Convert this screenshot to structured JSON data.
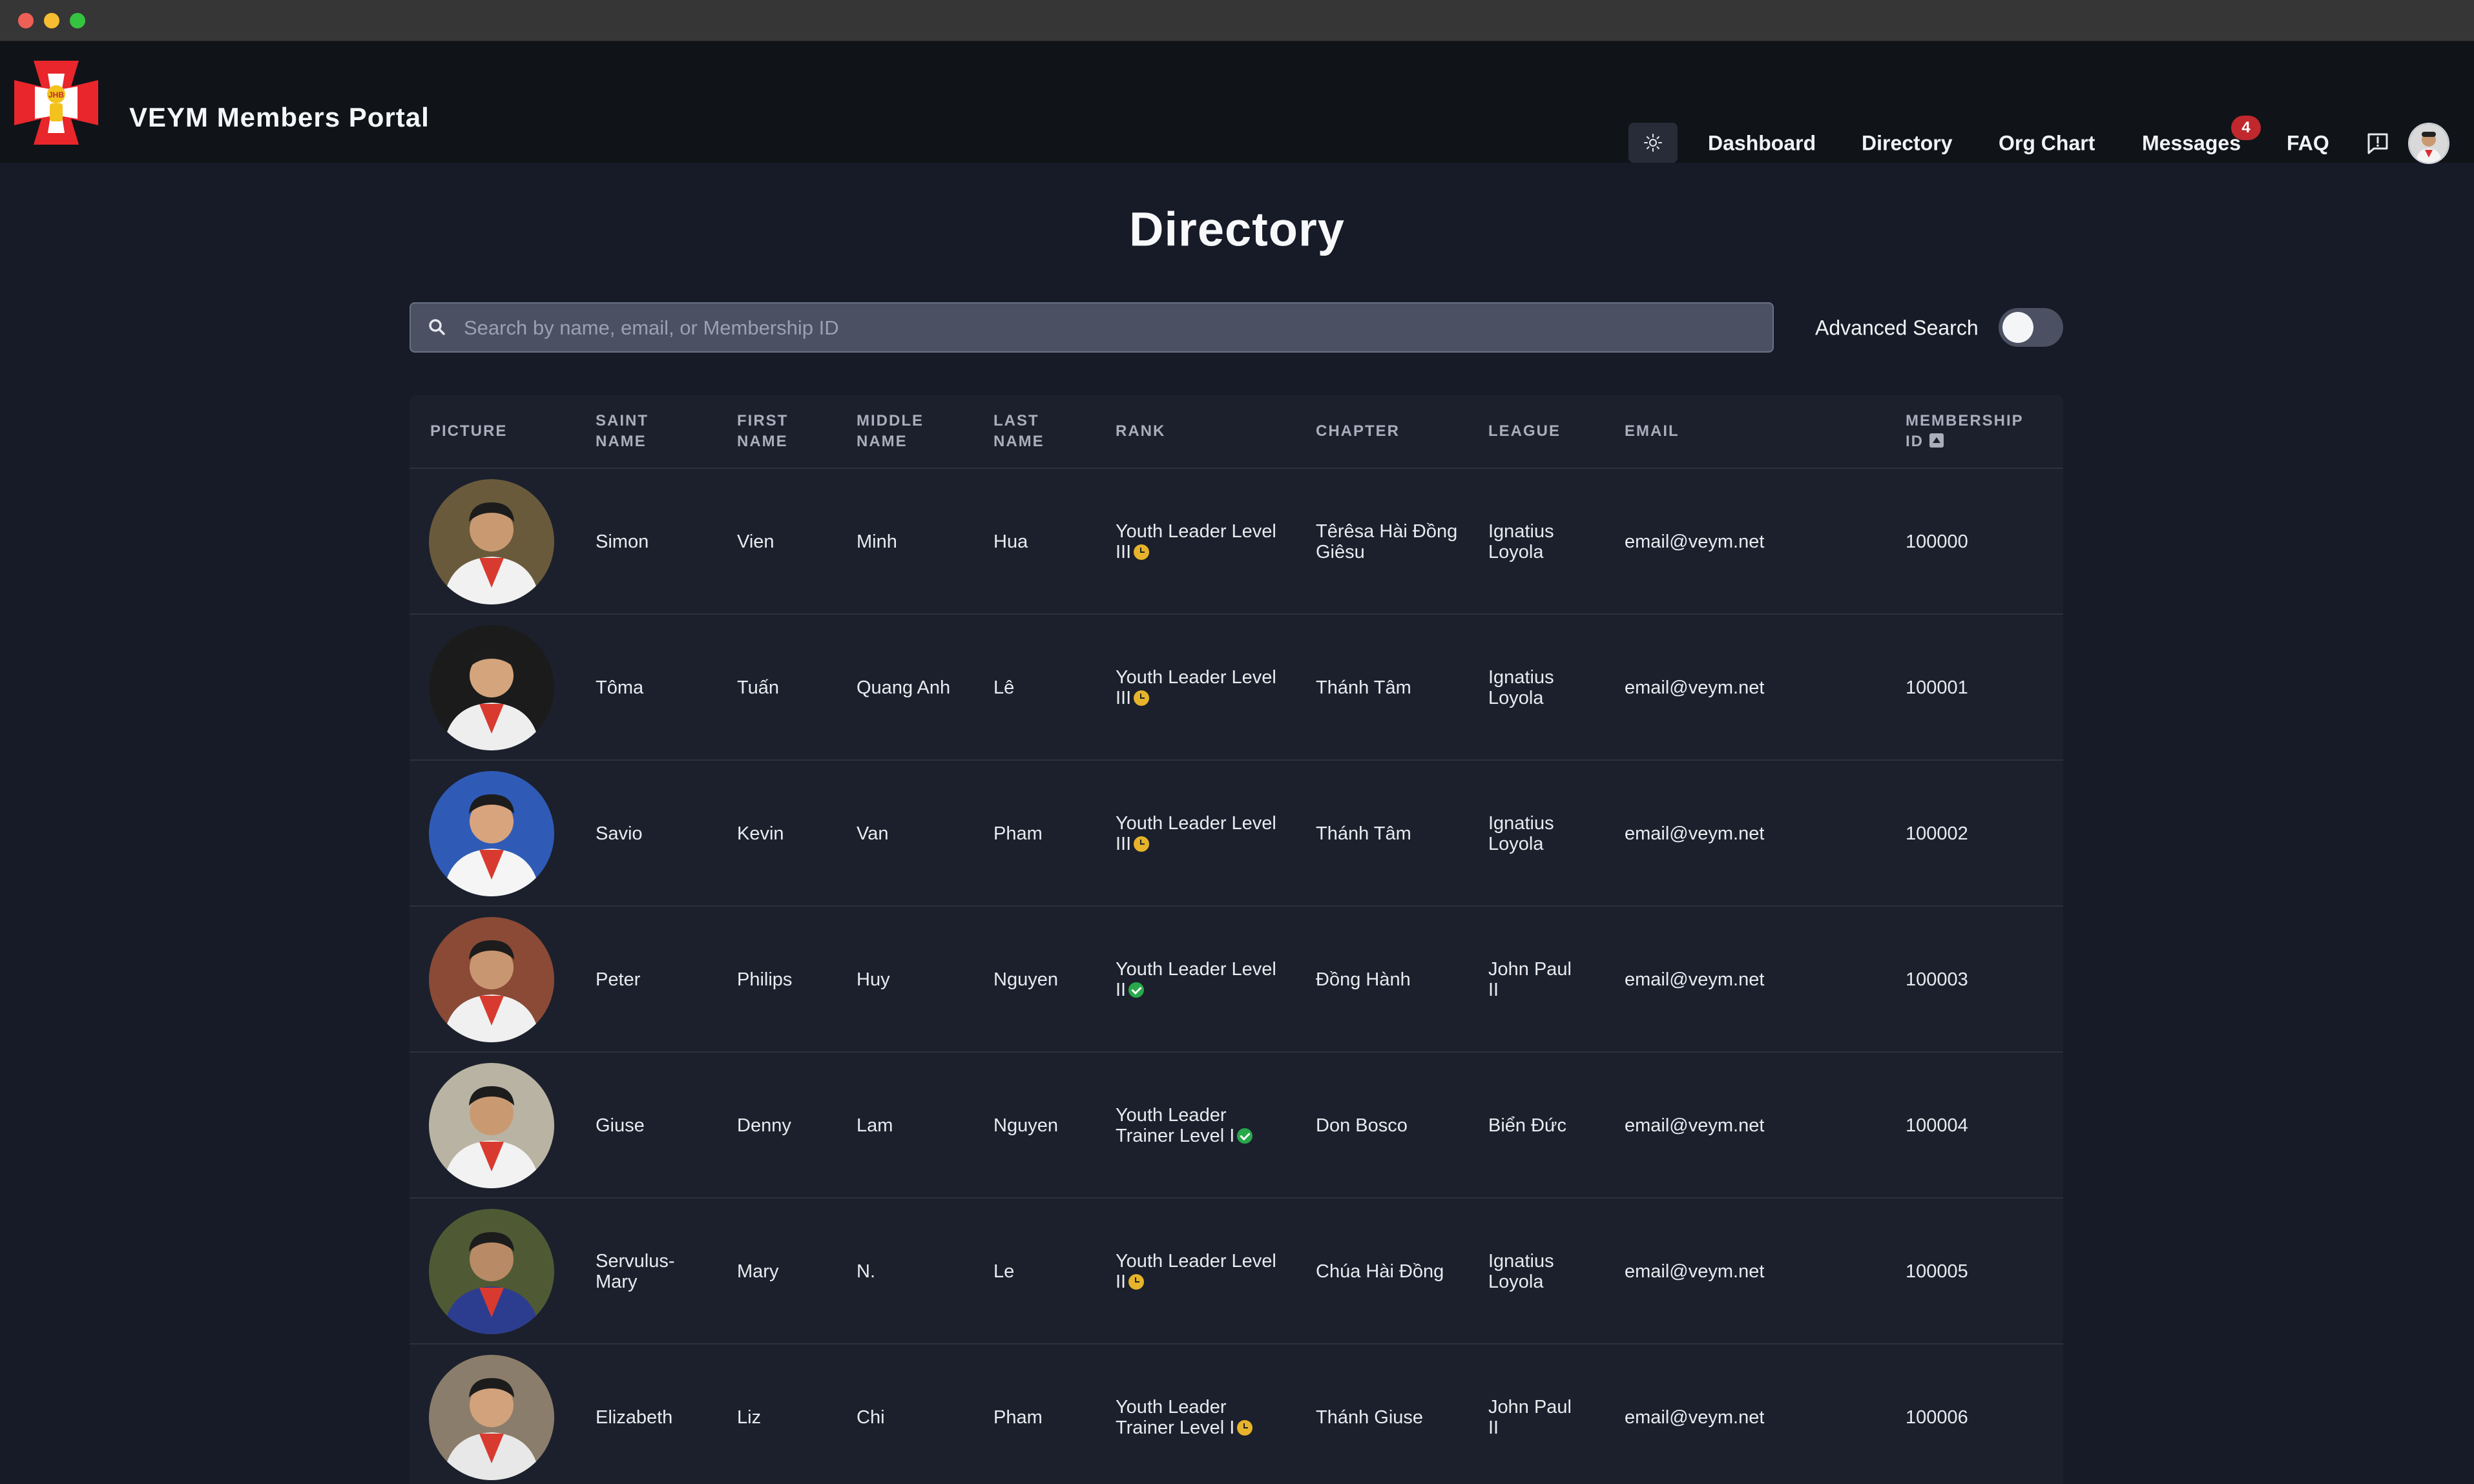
{
  "app": {
    "title": "VEYM Members Portal",
    "logo_text": "JHB"
  },
  "nav": {
    "links": [
      "Dashboard",
      "Directory",
      "Org Chart",
      "Messages",
      "FAQ"
    ],
    "messages_badge": "4"
  },
  "page": {
    "title": "Directory"
  },
  "search": {
    "placeholder": "Search by name, email, or Membership ID",
    "value": "",
    "advanced_label": "Advanced Search",
    "advanced_enabled": false
  },
  "table": {
    "headers": {
      "picture": "PICTURE",
      "saint_name": "SAINT NAME",
      "first_name": "FIRST NAME",
      "middle_name": "MIDDLE NAME",
      "last_name": "LAST NAME",
      "rank": "RANK",
      "chapter": "CHAPTER",
      "league": "LEAGUE",
      "email": "EMAIL",
      "membership_id": "MEMBERSHIP ID"
    },
    "rows": [
      {
        "saint": "Simon",
        "first": "Vien",
        "middle": "Minh",
        "last": "Hua",
        "rank": "Youth Leader Level III",
        "rank_status": "pending",
        "chapter": "Têrêsa Hài Đồng Giêsu",
        "league": "Ignatius Loyola",
        "email": "email@veym.net",
        "id": "100000",
        "avatar_bg": "#6a5a3c",
        "avatar_skin": "#c99a72",
        "avatar_shirt": "#f1f1f1"
      },
      {
        "saint": "Tôma",
        "first": "Tuấn",
        "middle": "Quang Anh",
        "last": "Lê",
        "rank": "Youth Leader Level III",
        "rank_status": "pending",
        "chapter": "Thánh Tâm",
        "league": "Ignatius Loyola",
        "email": "email@veym.net",
        "id": "100001",
        "avatar_bg": "#1b1b1b",
        "avatar_skin": "#d4a47c",
        "avatar_shirt": "#eeeeee"
      },
      {
        "saint": "Savio",
        "first": "Kevin",
        "middle": "Van",
        "last": "Pham",
        "rank": "Youth Leader Level III",
        "rank_status": "pending",
        "chapter": "Thánh Tâm",
        "league": "Ignatius Loyola",
        "email": "email@veym.net",
        "id": "100002",
        "avatar_bg": "#2f5bb7",
        "avatar_skin": "#d8a47e",
        "avatar_shirt": "#f5f5f5"
      },
      {
        "saint": "Peter",
        "first": "Philips",
        "middle": "Huy",
        "last": "Nguyen",
        "rank": "Youth Leader Level II",
        "rank_status": "verified",
        "chapter": "Đồng Hành",
        "league": "John Paul II",
        "email": "email@veym.net",
        "id": "100003",
        "avatar_bg": "#8a4a36",
        "avatar_skin": "#c89670",
        "avatar_shirt": "#f0f0f0"
      },
      {
        "saint": "Giuse",
        "first": "Denny",
        "middle": "Lam",
        "last": "Nguyen",
        "rank": "Youth Leader Trainer Level I",
        "rank_status": "verified",
        "chapter": "Don Bosco",
        "league": "Biển Đức",
        "email": "email@veym.net",
        "id": "100004",
        "avatar_bg": "#b9b3a3",
        "avatar_skin": "#c99a72",
        "avatar_shirt": "#f2f2f2"
      },
      {
        "saint": "Servulus-Mary",
        "first": "Mary",
        "middle": "N.",
        "last": "Le",
        "rank": "Youth Leader Level II",
        "rank_status": "pending",
        "chapter": "Chúa Hài Đồng",
        "league": "Ignatius Loyola",
        "email": "email@veym.net",
        "id": "100005",
        "avatar_bg": "#4f5a34",
        "avatar_skin": "#b88a66",
        "avatar_shirt": "#2c3d8f"
      },
      {
        "saint": "Elizabeth",
        "first": "Liz",
        "middle": "Chi",
        "last": "Pham",
        "rank": "Youth Leader Trainer Level I",
        "rank_status": "pending",
        "chapter": "Thánh Giuse",
        "league": "John Paul II",
        "email": "email@veym.net",
        "id": "100006",
        "avatar_bg": "#8b7d6b",
        "avatar_skin": "#d2a27c",
        "avatar_shirt": "#e8e8e8"
      }
    ]
  },
  "colors": {
    "background": "#171b27",
    "navbar": "#101318",
    "table": "#1b202c",
    "badge": "#c0282d",
    "status_pending": "#e6b32a",
    "status_verified": "#28a84a"
  }
}
